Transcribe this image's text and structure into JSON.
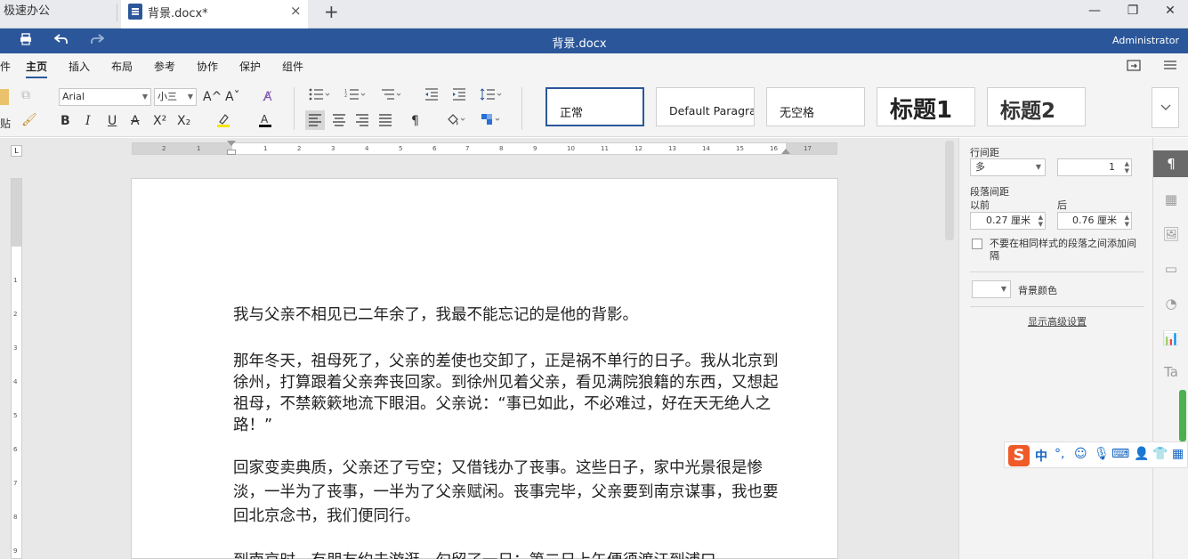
{
  "tabs": {
    "home": "极速办公",
    "document": "背景.docx*",
    "close": "×",
    "add": "+"
  },
  "window": {
    "minimize": "—",
    "restore": "❐",
    "close": "✕"
  },
  "titlebar": {
    "title": "背景.docx",
    "user": "Administrator",
    "icons": [
      "print-icon",
      "undo-icon",
      "redo-icon"
    ]
  },
  "menu": {
    "file_partial": "件",
    "items": [
      "主页",
      "插入",
      "布局",
      "参考",
      "协作",
      "保护",
      "组件"
    ],
    "active": "主页"
  },
  "toolbar": {
    "paste_partial": "贴",
    "font_name": "Arial",
    "font_size": "小三",
    "grow": "A^",
    "shrink": "Aˇ",
    "bold": "B",
    "italic": "I",
    "underline": "U",
    "strike": "A",
    "superscript": "X²",
    "subscript": "X₂",
    "pilcrow": "¶",
    "styles": [
      "正常",
      "Default Paragraph Font",
      "无空格",
      "标题1",
      "标题2"
    ],
    "selected_style": "正常",
    "more": "⌄"
  },
  "ruler": {
    "h_ticks": [
      "2",
      "1",
      "1",
      "2",
      "3",
      "4",
      "5",
      "6",
      "7",
      "8",
      "9",
      "10",
      "11",
      "12",
      "13",
      "14",
      "15",
      "16",
      "17"
    ],
    "v_ticks": [
      "1",
      "2",
      "3",
      "4",
      "5",
      "6",
      "7",
      "8",
      "9"
    ]
  },
  "document": {
    "paragraphs": [
      "我与父亲不相见已二年余了，我最不能忘记的是他的背影。",
      "那年冬天，祖母死了，父亲的差使也交卸了，正是祸不单行的日子。我从北京到徐州，打算跟着父亲奔丧回家。到徐州见着父亲，看见满院狼籍的东西，又想起祖母，不禁簌簌地流下眼泪。父亲说：“事已如此，不必难过，好在天无绝人之路！”",
      "回家变卖典质，父亲还了亏空；又借钱办了丧事。这些日子，家中光景很是惨淡，一半为了丧事，一半为了父亲赋闲。丧事完毕，父亲要到南京谋事，我也要回北京念书，我们便同行。",
      "到南京时，有朋友约去游逛，勾留了一日；第二日上午便须渡江到浦口"
    ]
  },
  "panel": {
    "line_spacing_label": "行间距",
    "line_spacing_type": "多",
    "line_spacing_value": "1",
    "para_spacing_label": "段落间距",
    "before_label": "以前",
    "after_label": "后",
    "before_value": "0.27 厘米",
    "after_value": "0.76 厘米",
    "no_space_same_style": "不要在相同样式的段落之间添加间隔",
    "background_color_label": "背景颜色",
    "advanced_link": "显示高级设置"
  },
  "ime": {
    "logo": "S",
    "mode": "中",
    "punct": "°,",
    "icons": [
      "emoji-icon",
      "mic-icon",
      "keyboard-icon",
      "user-icon",
      "shirt-icon",
      "grid-icon"
    ]
  }
}
